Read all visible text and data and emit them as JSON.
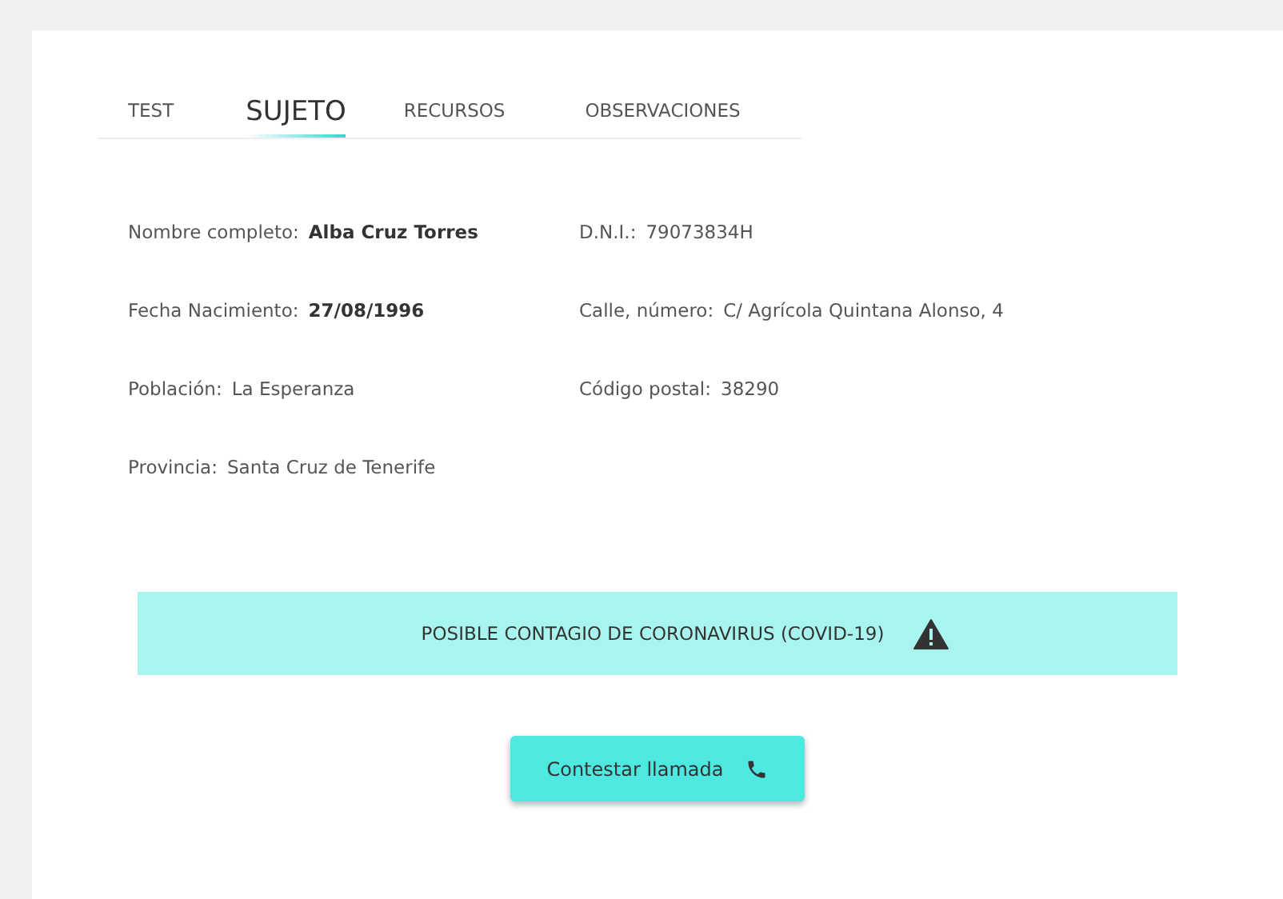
{
  "tabs": [
    {
      "label": "TEST",
      "selected": false
    },
    {
      "label": "SUJETO",
      "selected": true
    },
    {
      "label": "RECURSOS",
      "selected": false
    },
    {
      "label": "OBSERVACIONES",
      "selected": false
    }
  ],
  "subject": {
    "fields": [
      {
        "label": "Nombre completo:",
        "value": "Alba Cruz Torres",
        "emphasis": true
      },
      {
        "label": "D.N.I.:",
        "value": "79073834H",
        "emphasis": false
      },
      {
        "label": "Fecha Nacimiento:",
        "value": "27/08/1996",
        "emphasis": true
      },
      {
        "label": "Calle, número:",
        "value": "C/ Agrícola Quintana Alonso, 4",
        "emphasis": false
      },
      {
        "label": "Población:",
        "value": "La Esperanza",
        "emphasis": false
      },
      {
        "label": "Código postal:",
        "value": "38290",
        "emphasis": false
      },
      {
        "label": "Provincia:",
        "value": "Santa Cruz de Tenerife",
        "emphasis": false
      }
    ]
  },
  "alert": {
    "text": "POSIBLE CONTAGIO DE CORONAVIRUS (COVID-19)"
  },
  "action_button": {
    "label": "Contestar llamada"
  }
}
